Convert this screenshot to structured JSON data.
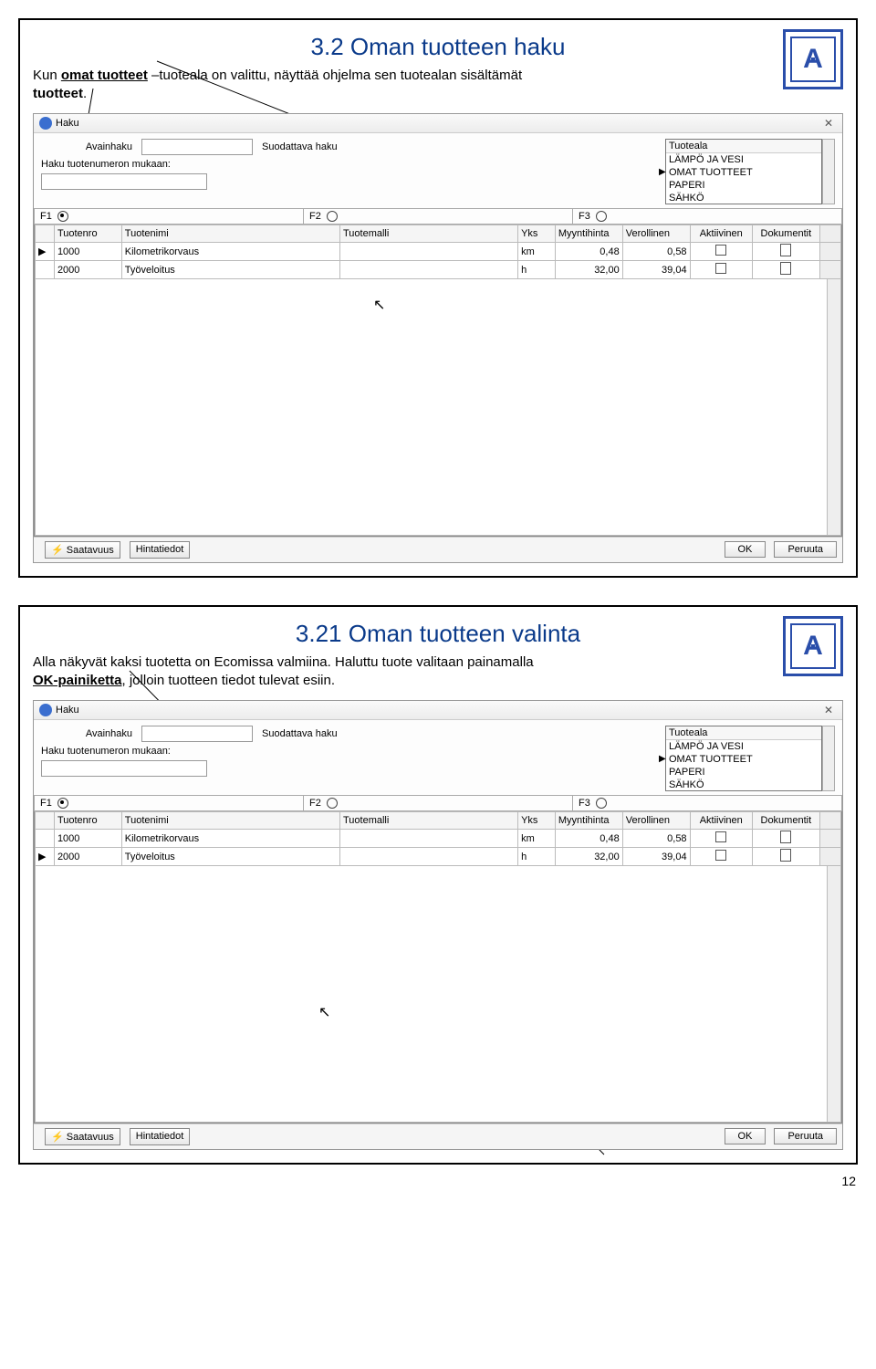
{
  "page_number": "12",
  "slide1": {
    "title": "3.2 Oman tuotteen haku",
    "desc_pre": "Kun ",
    "desc_bold1": "omat tuotteet",
    "desc_mid": " –tuoteala on valittu, näyttää ohjelma sen tuotealan sisältämät ",
    "desc_bold2": "tuotteet",
    "desc_end": "."
  },
  "slide2": {
    "title": "3.21 Oman tuotteen valinta",
    "line1": "Alla näkyvät kaksi tuotetta on Ecomissa valmiina. Haluttu tuote valitaan painamalla",
    "line2_pre": "",
    "line2_bold": "OK-painiketta",
    "line2_end": ", jolloin tuotteen tiedot tulevat esiin."
  },
  "logo_letter": "A",
  "haku": {
    "title": "Haku",
    "close": "✕",
    "avainhaku": "Avainhaku",
    "suodattava": "Suodattava haku",
    "numerolabel": "Haku tuotenumeron mukaan:",
    "listheader": "Tuoteala",
    "listitems": [
      "LÄMPÖ JA VESI",
      "OMAT TUOTTEET",
      "PAPERI",
      "SÄHKÖ"
    ],
    "f1": "F1",
    "f2": "F2",
    "f3": "F3",
    "cols": {
      "tuotenro": "Tuotenro",
      "tuotenimi": "Tuotenimi",
      "tuotemalli": "Tuotemalli",
      "yks": "Yks",
      "myyntihinta": "Myyntihinta",
      "verollinen": "Verollinen",
      "aktiivinen": "Aktiivinen",
      "dokumentit": "Dokumentit"
    },
    "rows": [
      {
        "nro": "1000",
        "nimi": "Kilometrikorvaus",
        "malli": "",
        "yks": "km",
        "mh": "0,48",
        "ver": "0,58"
      },
      {
        "nro": "2000",
        "nimi": "Työveloitus",
        "malli": "",
        "yks": "h",
        "mh": "32,00",
        "ver": "39,04"
      }
    ],
    "saatavuus": "Saatavuus",
    "hintatiedot": "Hintatiedot",
    "ok": "OK",
    "peruuta": "Peruuta"
  }
}
